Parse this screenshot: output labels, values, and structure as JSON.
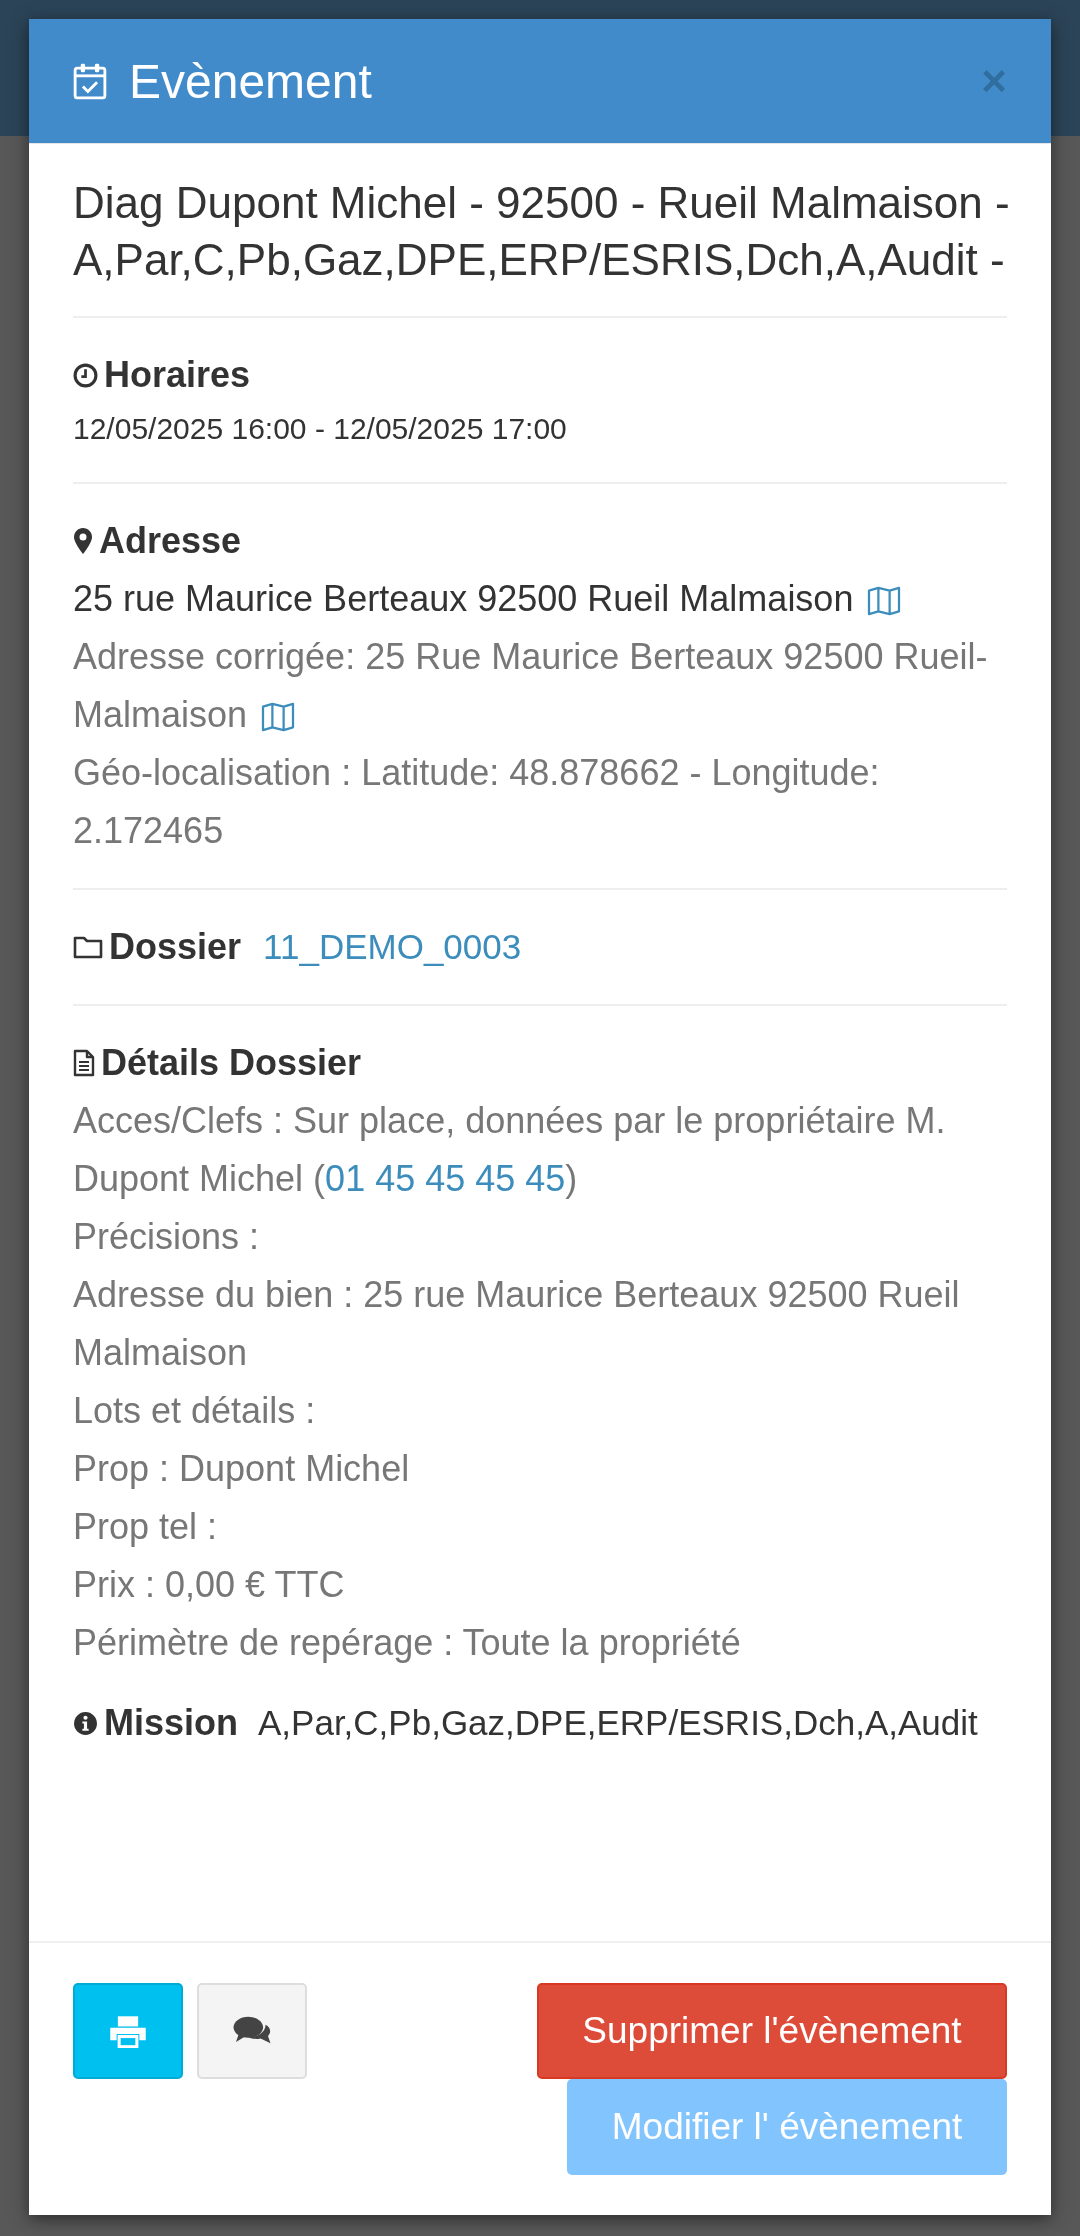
{
  "modal": {
    "title": "Evènement",
    "close": "×",
    "event_title": "Diag Dupont Michel - 92500 - Rueil Malmaison - A,Par,C,Pb,Gaz,DPE,ERP/ESRIS,Dch,A,Audit -",
    "schedule": {
      "heading": "Horaires",
      "value": "12/05/2025 16:00 - 12/05/2025 17:00"
    },
    "address": {
      "heading": "Adresse",
      "lines": [
        {
          "kind": "main",
          "text": "25 rue Maurice Berteaux 92500 Rueil Malmaison",
          "map": true
        },
        {
          "kind": "muted",
          "text": "Adresse corrigée: 25 Rue Maurice Berteaux 92500 Rueil-Malmaison",
          "map": true
        },
        {
          "kind": "muted",
          "text": "Géo-localisation : Latitude: 48.878662 - Longitude: 2.172465",
          "map": false
        }
      ]
    },
    "folder": {
      "heading": "Dossier",
      "link": "11_DEMO_0003"
    },
    "details": {
      "heading": "Détails Dossier",
      "lines": [
        [
          {
            "kind": "text",
            "text": "Acces/Clefs : Sur place, données par le propriétaire M. Dupont Michel ("
          },
          {
            "kind": "link",
            "text": "01 45 45 45 45"
          },
          {
            "kind": "text",
            "text": ")"
          }
        ],
        [
          {
            "kind": "text",
            "text": "Précisions :"
          }
        ],
        [
          {
            "kind": "text",
            "text": "Adresse du bien : 25 rue Maurice Berteaux 92500 Rueil Malmaison"
          }
        ],
        [
          {
            "kind": "text",
            "text": "Lots et détails :"
          }
        ],
        [
          {
            "kind": "text",
            "text": "Prop : Dupont Michel"
          }
        ],
        [
          {
            "kind": "text",
            "text": "Prop tel :"
          }
        ],
        [
          {
            "kind": "text",
            "text": "Prix : 0,00 € TTC"
          }
        ],
        [
          {
            "kind": "text",
            "text": "Périmètre de repérage : Toute la propriété"
          }
        ]
      ]
    },
    "mission": {
      "heading": "Mission",
      "value": "A,Par,C,Pb,Gaz,DPE,ERP/ESRIS,Dch,A,Audit"
    },
    "icon_buttons": [
      {
        "kind": "print"
      },
      {
        "kind": "comment"
      }
    ],
    "buttons": [
      {
        "kind": "danger",
        "label": "Supprimer l'évènement",
        "disabled": false
      },
      {
        "kind": "primary",
        "label": "Modifier l' évènement",
        "disabled": true
      }
    ]
  }
}
